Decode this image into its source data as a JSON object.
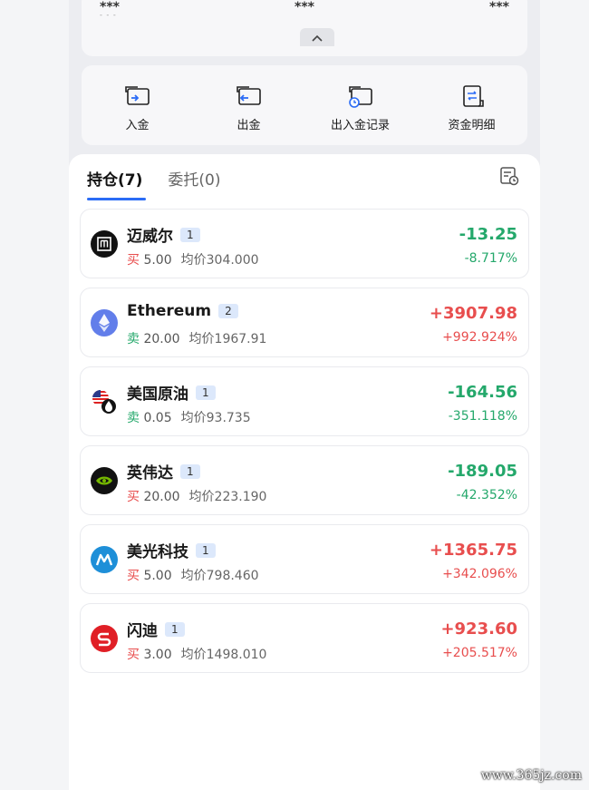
{
  "summary": {
    "values": [
      "***",
      "***",
      "***"
    ],
    "sub": "- - -"
  },
  "actions": [
    {
      "label": "入金",
      "icon": "deposit-icon"
    },
    {
      "label": "出金",
      "icon": "withdraw-icon"
    },
    {
      "label": "出入金记录",
      "icon": "fund-record-icon"
    },
    {
      "label": "资金明细",
      "icon": "fund-detail-icon"
    }
  ],
  "tabs": [
    {
      "label": "持仓(7)",
      "active": true
    },
    {
      "label": "委托(0)",
      "active": false
    }
  ],
  "positions": [
    {
      "name": "迈威尔",
      "badge": "1",
      "side": "买",
      "qty": "5.00",
      "avg": "均价304.000",
      "pl": "-13.25",
      "pct": "-8.717%",
      "icon": "marvell-logo-icon",
      "dir": "neg"
    },
    {
      "name": "Ethereum",
      "badge": "2",
      "side": "卖",
      "qty": "20.00",
      "avg": "均价1967.91",
      "pl": "+3907.98",
      "pct": "+992.924%",
      "icon": "ethereum-logo-icon",
      "dir": "pos"
    },
    {
      "name": "美国原油",
      "badge": "1",
      "side": "卖",
      "qty": "0.05",
      "avg": "均价93.735",
      "pl": "-164.56",
      "pct": "-351.118%",
      "icon": "us-oil-icon",
      "dir": "neg"
    },
    {
      "name": "英伟达",
      "badge": "1",
      "side": "买",
      "qty": "20.00",
      "avg": "均价223.190",
      "pl": "-189.05",
      "pct": "-42.352%",
      "icon": "nvidia-logo-icon",
      "dir": "neg"
    },
    {
      "name": "美光科技",
      "badge": "1",
      "side": "买",
      "qty": "5.00",
      "avg": "均价798.460",
      "pl": "+1365.75",
      "pct": "+342.096%",
      "icon": "micron-logo-icon",
      "dir": "pos"
    },
    {
      "name": "闪迪",
      "badge": "1",
      "side": "买",
      "qty": "3.00",
      "avg": "均价1498.010",
      "pl": "+923.60",
      "pct": "+205.517%",
      "icon": "sandisk-logo-icon",
      "dir": "pos"
    }
  ],
  "watermark": "www.365jz.com",
  "colors": {
    "accent": "#2b6cf6",
    "up": "#e84e4e",
    "down": "#24a86b"
  }
}
